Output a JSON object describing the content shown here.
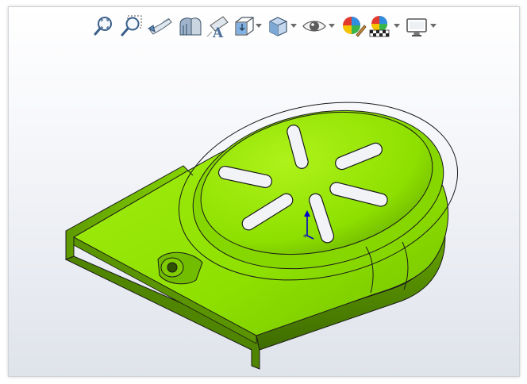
{
  "window": {
    "title": "",
    "background_top": "#ffffff",
    "background_bottom": "#dfe3ea"
  },
  "heads_up_toolbar": {
    "tools": [
      {
        "id": "zoom-to-fit",
        "icon": "zoom-to-fit-icon",
        "has_dropdown": false
      },
      {
        "id": "zoom-to-area",
        "icon": "zoom-to-area-icon",
        "has_dropdown": false
      },
      {
        "id": "previous-view",
        "icon": "previous-view-icon",
        "has_dropdown": false
      },
      {
        "id": "section-view",
        "icon": "section-view-icon",
        "has_dropdown": false
      },
      {
        "id": "dynamic-annotation-views",
        "icon": "dynamic-annotation-icon",
        "has_dropdown": false
      },
      {
        "id": "view-orientation",
        "icon": "view-orientation-icon",
        "has_dropdown": true
      },
      {
        "id": "display-style",
        "icon": "display-style-icon",
        "has_dropdown": true
      },
      {
        "id": "hide-show-items",
        "icon": "eye-icon",
        "has_dropdown": true
      },
      {
        "id": "edit-appearance",
        "icon": "edit-appearance-icon",
        "has_dropdown": false
      },
      {
        "id": "apply-scene",
        "icon": "apply-scene-icon",
        "has_dropdown": true
      },
      {
        "id": "view-settings",
        "icon": "monitor-icon",
        "has_dropdown": true
      }
    ]
  },
  "model": {
    "part_color": "#8ee000",
    "edge_color": "#1a1a1a",
    "shadow_color": "#3e6b00",
    "triad_colors": {
      "y_axis": "#0000cc",
      "origin": "#0000cc"
    }
  }
}
